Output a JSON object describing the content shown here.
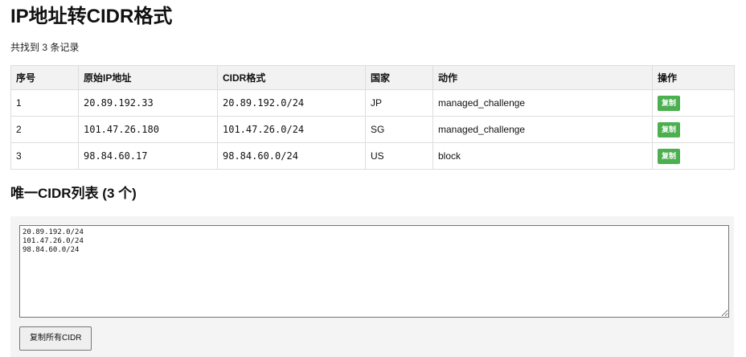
{
  "page": {
    "title": "IP地址转CIDR格式",
    "summary": "共找到 3 条记录"
  },
  "table": {
    "headers": [
      "序号",
      "原始IP地址",
      "CIDR格式",
      "国家",
      "动作",
      "操作"
    ],
    "rows": [
      {
        "index": "1",
        "ip": "20.89.192.33",
        "cidr": "20.89.192.0/24",
        "country": "JP",
        "action": "managed_challenge",
        "button": "复制"
      },
      {
        "index": "2",
        "ip": "101.47.26.180",
        "cidr": "101.47.26.0/24",
        "country": "SG",
        "action": "managed_challenge",
        "button": "复制"
      },
      {
        "index": "3",
        "ip": "98.84.60.17",
        "cidr": "98.84.60.0/24",
        "country": "US",
        "action": "block",
        "button": "复制"
      }
    ]
  },
  "unique": {
    "title": "唯一CIDR列表 (3 个)",
    "textarea_value": "20.89.192.0/24\n101.47.26.0/24\n98.84.60.0/24",
    "copy_all_label": "复制所有CIDR"
  },
  "colors": {
    "copy_button_bg": "#4caf50",
    "header_bg": "#f2f2f2",
    "panel_bg": "#f4f4f4"
  }
}
